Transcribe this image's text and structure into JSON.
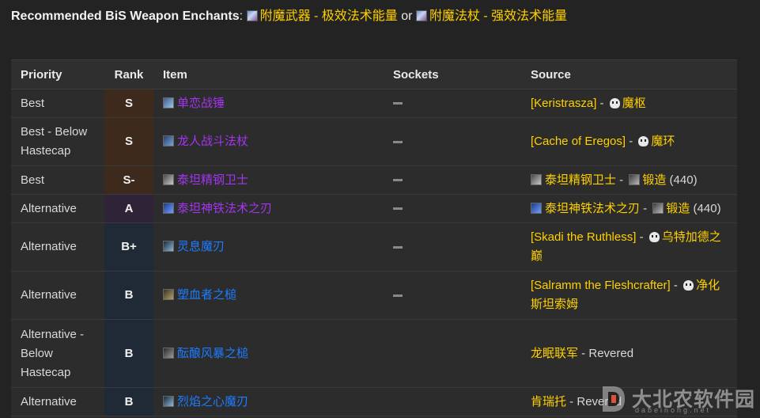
{
  "header": {
    "label": "Recommended BiS Weapon Enchants",
    "colon": ":",
    "enchant1": "附魔武器 - 极效法术能量",
    "or": "or",
    "enchant2": "附魔法杖 - 强效法术能量",
    "scroll_icon": "enchant-scroll-icon"
  },
  "table": {
    "headers": {
      "priority": "Priority",
      "rank": "Rank",
      "item": "Item",
      "sockets": "Sockets",
      "source": "Source"
    },
    "rows": [
      {
        "priority": "Best",
        "rank": "S",
        "item": "单恋战锤",
        "sockets": "—",
        "src_a": "[Keristrasza]",
        "src_sep": " - ",
        "src_b": "魔枢",
        "src_c": ""
      },
      {
        "priority": "Best - Below Hastecap",
        "rank": "S",
        "item": "龙人战斗法杖",
        "sockets": "—",
        "src_a": "[Cache of Eregos]",
        "src_sep": " - ",
        "src_b": "魔环",
        "src_c": ""
      },
      {
        "priority": "Best",
        "rank": "S-",
        "item": "泰坦精钢卫士",
        "sockets": "—",
        "src_a": "泰坦精钢卫士",
        "src_sep": " - ",
        "src_b": "锻造",
        "src_c": " (440)"
      },
      {
        "priority": "Alternative",
        "rank": "A",
        "item": "泰坦神铁法术之刃",
        "sockets": "—",
        "src_a": "泰坦神铁法术之刃",
        "src_sep": " - ",
        "src_b": "锻造",
        "src_c": " (440)"
      },
      {
        "priority": "Alternative",
        "rank": "B+",
        "item": "灵息魔刃",
        "sockets": "—",
        "src_a": "[Skadi the Ruthless]",
        "src_sep": " - ",
        "src_b": "乌特加德之巅",
        "src_c": ""
      },
      {
        "priority": "Alternative",
        "rank": "B",
        "item": "塑血者之槌",
        "sockets": "—",
        "src_a": "[Salramm the Fleshcrafter]",
        "src_sep": " - ",
        "src_b": "净化斯坦索姆",
        "src_c": ""
      },
      {
        "priority": "Alternative - Below Hastecap",
        "rank": "B",
        "item": "酝酿风暴之槌",
        "sockets": "",
        "src_a": "龙眠联军",
        "src_sep": " - ",
        "src_b": "Revered",
        "src_c": ""
      },
      {
        "priority": "Alternative",
        "rank": "B",
        "item": "烈焰之心魔刃",
        "sockets": "",
        "src_a": "肯瑞托",
        "src_sep": " - ",
        "src_b": "Revered",
        "src_c": ""
      }
    ]
  },
  "watermark": {
    "title": "大北农软件园",
    "sub": "dabeinong.net"
  },
  "colors": {
    "gold": "#ffd100",
    "epic": "#a335ee",
    "rare": "#1e7cff",
    "rank_s": "#3e2a1c",
    "rank_a": "#2f2437",
    "rank_b": "#202a37"
  }
}
